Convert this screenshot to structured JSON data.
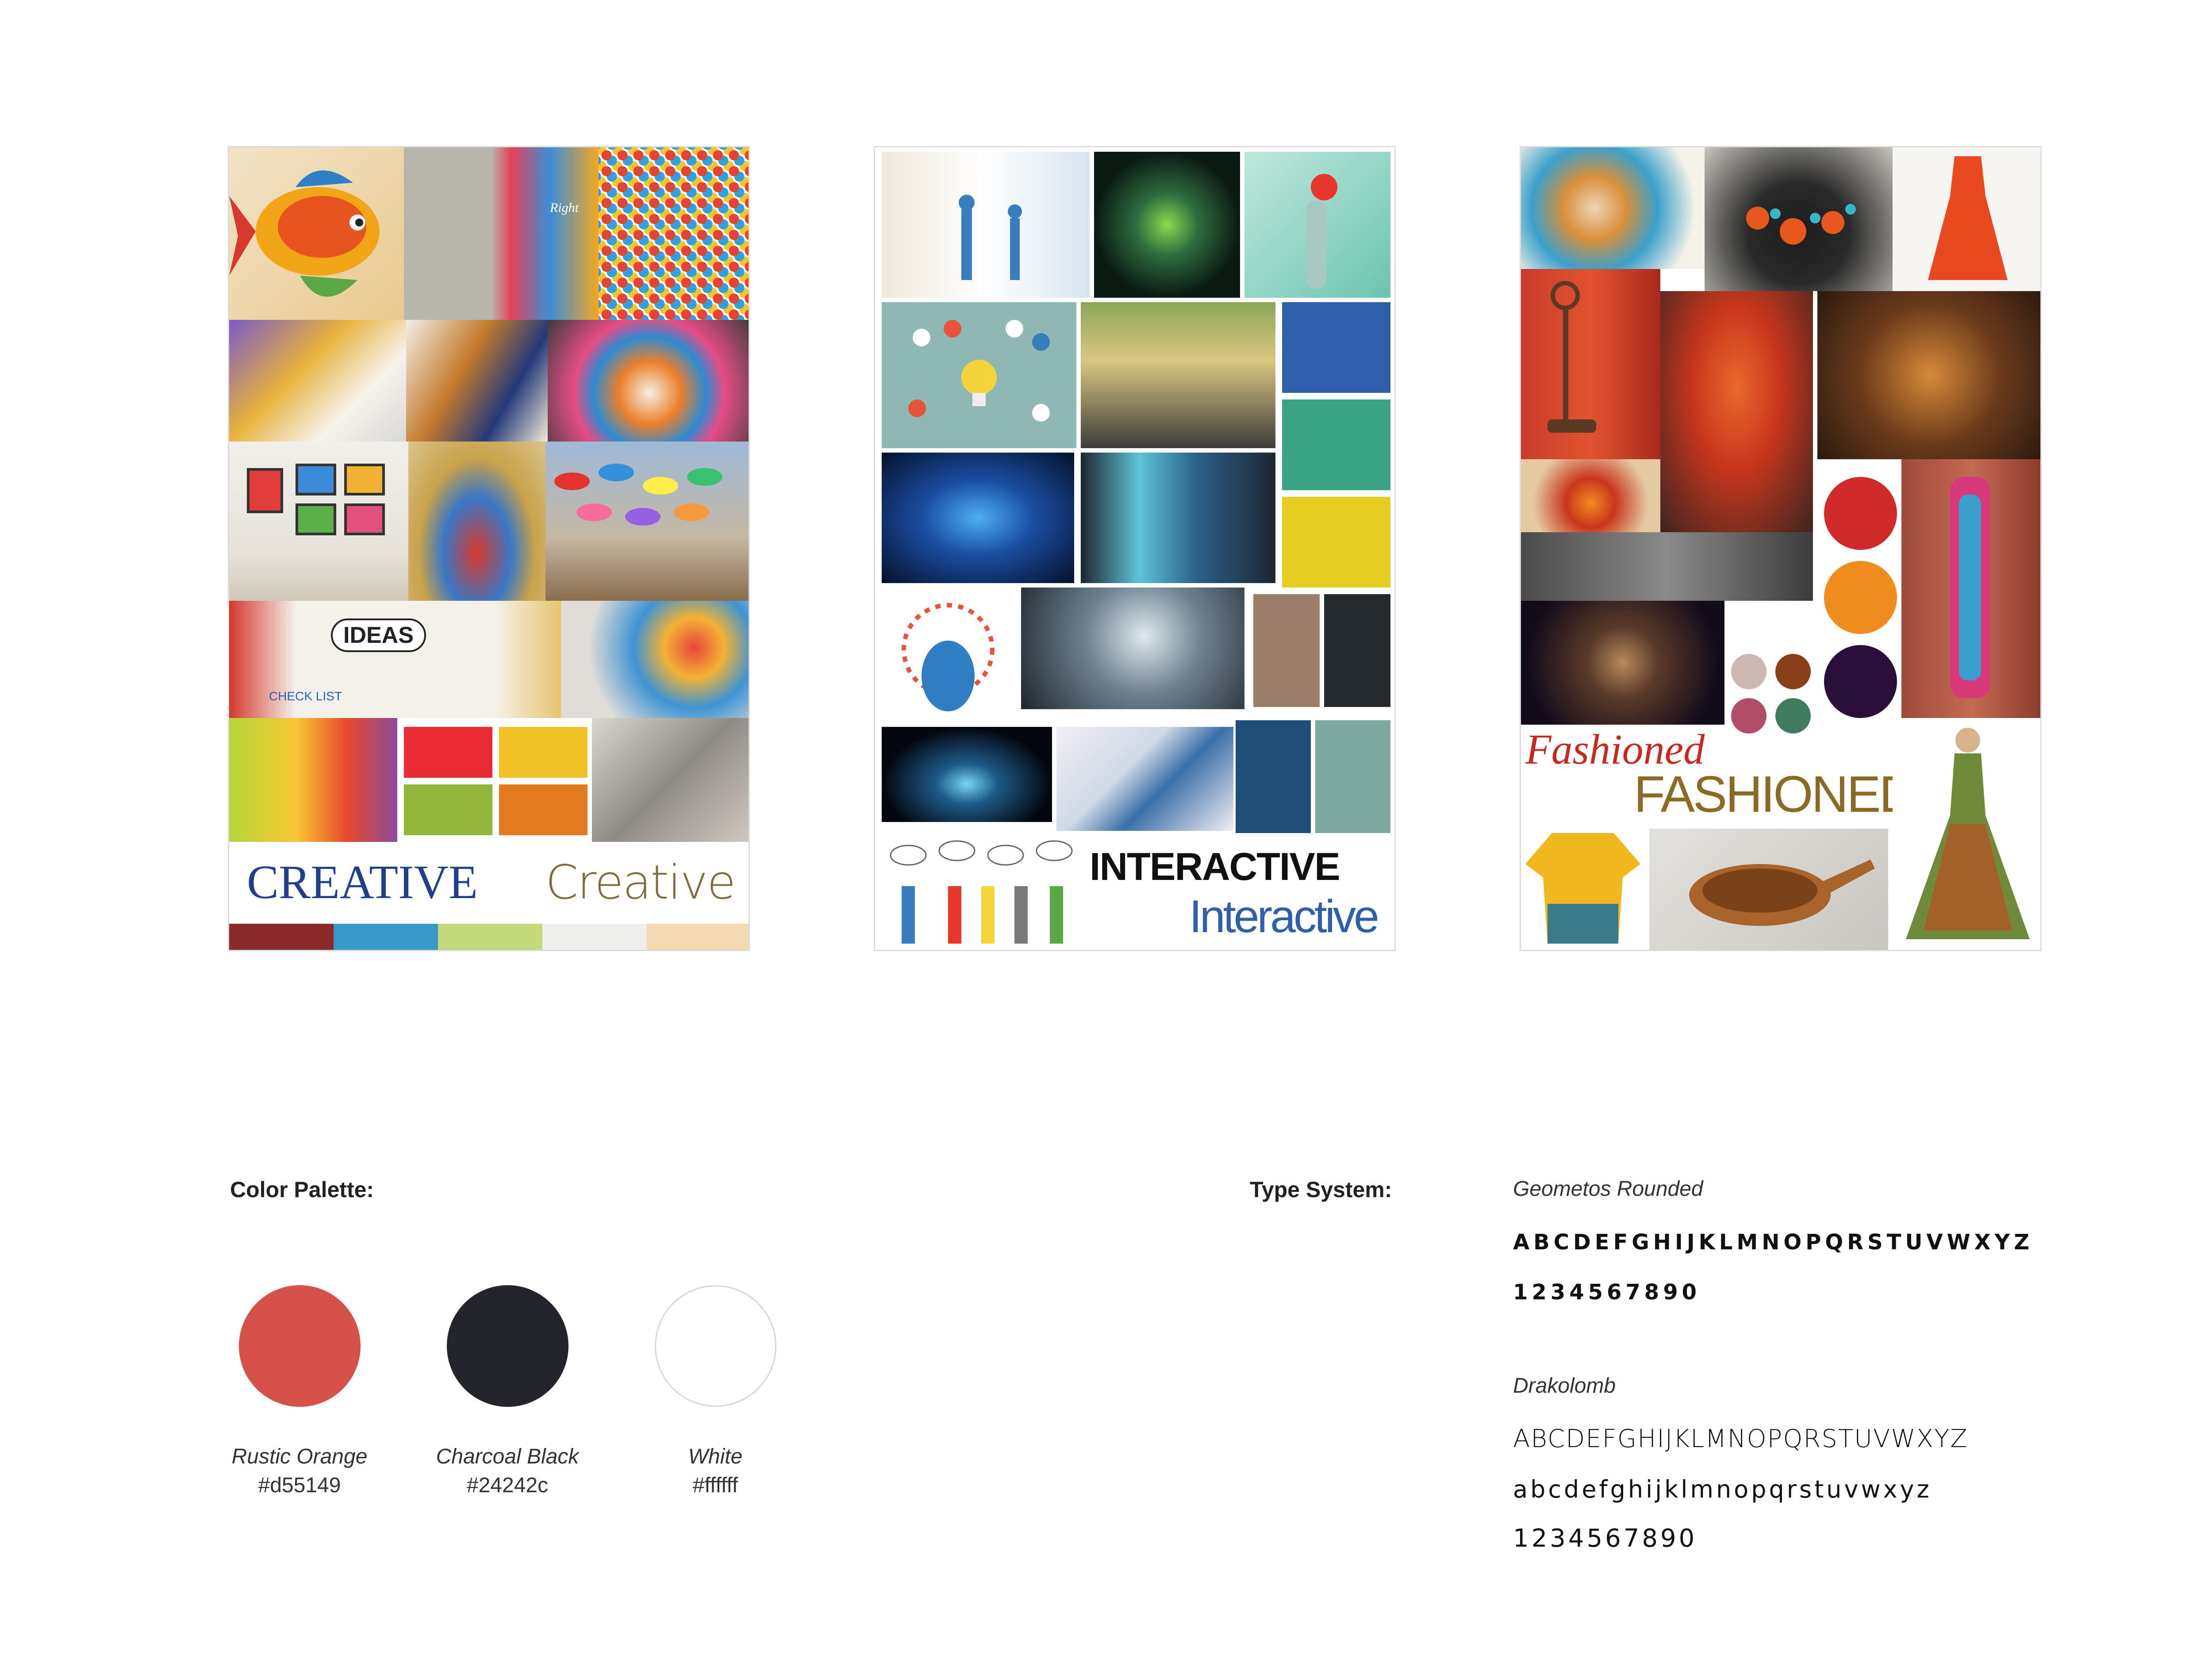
{
  "boards": {
    "creative": {
      "title_caps": "CREATIVE",
      "title_script": "Creative",
      "tile_text": {
        "right": "Right",
        "ideas": "IDEAS",
        "check": "CHECK LIST"
      },
      "swatches": [
        "#ea2b33",
        "#f0c225",
        "#93b63a",
        "#e47a1f"
      ],
      "bottom_strip": [
        "#8b2a2a",
        "#3a9ac7",
        "#c4d97c",
        "#eeeeea",
        "#f3d9b1"
      ]
    },
    "interactive": {
      "title_caps": "INTERACTIVE",
      "title_script": "Interactive",
      "swatches": [
        "#2f5faa",
        "#3aa384",
        "#e6cb21",
        "#9b7d6a",
        "#23292d",
        "#1f4e79",
        "#7ea9a0"
      ]
    },
    "fashioned": {
      "title_script": "Fashioned",
      "title_caps": "FASHIONED",
      "swatches": [
        "#d02a2a",
        "#f08c1e",
        "#2a0f3a",
        "#cdb8b1",
        "#8a3f1a",
        "#b04e6a",
        "#3f7b5f"
      ]
    }
  },
  "color_palette": {
    "label": "Color Palette:",
    "colors": [
      {
        "name": "Rustic Orange",
        "hex": "#d55149"
      },
      {
        "name": "Charcoal Black",
        "hex": "#24242c"
      },
      {
        "name": "White",
        "hex": "#ffffff"
      }
    ]
  },
  "type_system": {
    "label": "Type System:",
    "fonts": [
      {
        "name": "Geometos Rounded",
        "uppercase": "ABCDEFGHIJKLMNOPQRSTUVWXYZ",
        "numerals": "1234567890"
      },
      {
        "name": "Drakolomb",
        "uppercase": "ABCDEFGHIJKLMNOPQRSTUVWXYZ",
        "lowercase": "abcdefghijklmnopqrstuvwxyz",
        "numerals": "1234567890"
      }
    ]
  }
}
